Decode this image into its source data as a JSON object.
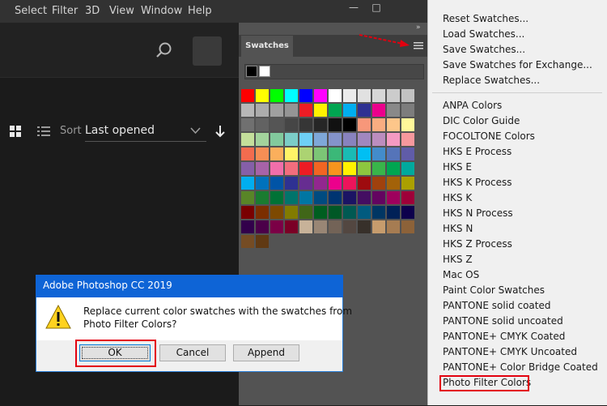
{
  "menubar": {
    "items": [
      "Select",
      "Filter",
      "3D",
      "View",
      "Window",
      "Help"
    ],
    "minimize_glyph": "—",
    "maximize_glyph": "□",
    "collapse_glyph": "»"
  },
  "home": {
    "sort_label": "Sort",
    "sort_value": "Last opened",
    "icons": [
      "search-icon",
      "grid-view-icon",
      "list-view-icon",
      "chevron-down-icon",
      "sort-down-arrow-icon"
    ]
  },
  "panel": {
    "tab_label": "Swatches",
    "foreground_color": "#000000",
    "background_color": "#ffffff",
    "swatch_rows": [
      [
        "#ff0000",
        "#ffff00",
        "#00ff00",
        "#00ffff",
        "#0000ff",
        "#ff00ff",
        "#ffffff",
        "#ebebeb",
        "#e1e1e1",
        "#d7d7d7",
        "#cccccc",
        "#c2c2c2"
      ],
      [
        "#b7b7b7",
        "#acacac",
        "#a0a0a0",
        "#959595",
        "#ed1c24",
        "#fff200",
        "#00a651",
        "#00aeef",
        "#2e3192",
        "#ec008c",
        "#898989",
        "#7d7d7d"
      ],
      [
        "#707070",
        "#626262",
        "#555555",
        "#464646",
        "#363636",
        "#262626",
        "#111111",
        "#000000",
        "#f7977a",
        "#f9ad81",
        "#fdc68a",
        "#fff79a"
      ],
      [
        "#c4df9b",
        "#a3d39c",
        "#82ca9d",
        "#7bcdc8",
        "#6ecff6",
        "#7ea7d8",
        "#8493ca",
        "#8882be",
        "#a187be",
        "#bc8dbf",
        "#f49ac2",
        "#f6989d"
      ],
      [
        "#f26c4f",
        "#f68e55",
        "#fbaf5c",
        "#fff467",
        "#acd372",
        "#7cc576",
        "#3bb878",
        "#1abbb4",
        "#00bff3",
        "#438ccb",
        "#5574b9",
        "#605ca8"
      ],
      [
        "#855fa8",
        "#a763a8",
        "#f06eaa",
        "#f26d7d",
        "#ed1c24",
        "#f26522",
        "#f7941d",
        "#fff200",
        "#8dc63f",
        "#39b54a",
        "#00a651",
        "#00a99d"
      ],
      [
        "#00aeef",
        "#0072bc",
        "#0054a6",
        "#2e3192",
        "#662d91",
        "#92278f",
        "#ec008c",
        "#ed145b",
        "#9e0b0f",
        "#a0410d",
        "#a36209",
        "#aba000"
      ],
      [
        "#598527",
        "#1a7b30",
        "#007236",
        "#00746b",
        "#0076a3",
        "#004b80",
        "#003471",
        "#1b1464",
        "#440e62",
        "#630460",
        "#9e005d",
        "#9e0039"
      ],
      [
        "#790000",
        "#7b2e00",
        "#7d4900",
        "#827b00",
        "#406618",
        "#005e20",
        "#005826",
        "#005952",
        "#005b7f",
        "#003663",
        "#002157",
        "#0d004c"
      ],
      [
        "#32004b",
        "#4b0049",
        "#7b0046",
        "#7a0026",
        "#c7b299",
        "#998675",
        "#736357",
        "#534741",
        "#37302a",
        "#c69c6d",
        "#a67c52",
        "#8c6239"
      ],
      [
        "#754c24",
        "#603913"
      ]
    ]
  },
  "context_menu": {
    "group1": [
      "Reset Swatches...",
      "Load Swatches...",
      "Save Swatches...",
      "Save Swatches for Exchange...",
      "Replace Swatches..."
    ],
    "group2": [
      "ANPA Colors",
      "DIC Color Guide",
      "FOCOLTONE Colors",
      "HKS E Process",
      "HKS E",
      "HKS K Process",
      "HKS K",
      "HKS N Process",
      "HKS N",
      "HKS Z Process",
      "HKS Z",
      "Mac OS",
      "Paint Color Swatches",
      "PANTONE solid coated",
      "PANTONE solid uncoated",
      "PANTONE+ CMYK Coated",
      "PANTONE+ CMYK Uncoated",
      "PANTONE+ Color Bridge Coated",
      "Photo Filter Colors"
    ]
  },
  "dialog": {
    "title": "Adobe Photoshop CC 2019",
    "message_line1": "Replace current color swatches with the swatches from",
    "message_line2": "Photo Filter Colors?",
    "ok_label": "OK",
    "cancel_label": "Cancel",
    "append_label": "Append"
  },
  "colors": {
    "highlight": "#e3000f",
    "dialog_title_bar": "#0e64d6",
    "panel_bg": "#535353"
  }
}
